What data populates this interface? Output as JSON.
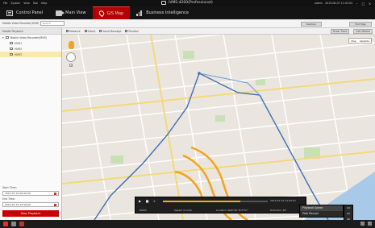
{
  "titlebar": {
    "menu": [
      "File",
      "System",
      "View",
      "Tool",
      "Help"
    ],
    "app_title": "iVMS-4200(Professional)",
    "user_info": "admin",
    "clock": "2015-08-07 11:03:24"
  },
  "tabs": [
    {
      "label": "Control Panel",
      "icon": "control-panel-icon",
      "active": false
    },
    {
      "label": "Main View",
      "icon": "main-view-icon",
      "active": false
    },
    {
      "label": "GIS Map",
      "icon": "gis-map-icon",
      "active": true
    },
    {
      "label": "Business Intelligence",
      "icon": "business-intelligence-icon",
      "active": false
    }
  ],
  "searchrow": {
    "label": "Mobile Video Recorder(MVR)",
    "search_placeholder": "Search",
    "restore_label": "Restore",
    "exit_label": "Exit Map"
  },
  "leftpanel": {
    "header": "Mobile Playback",
    "tree_root": "Mobile Video Recorder(MVR)",
    "tree_items": [
      "MVR1",
      "MVR2",
      "MVR3"
    ],
    "selected_index": 2,
    "start_label": "Start Time:",
    "start_value": "2015-07-31 00:00:00",
    "end_label": "End Time:",
    "end_value": "2015-07-31 23:59:59",
    "stop_label": "Stop Playback"
  },
  "maptoolbar": {
    "items": [
      "Measure",
      "Select",
      "Send Message",
      "Position"
    ],
    "show_track_label": "Show Track",
    "exit_track_label": "Exit Mobile"
  },
  "map": {
    "map_type_options": [
      "Map",
      "Satellite"
    ]
  },
  "playbar": {
    "progress": 0.74,
    "time_display": "2015-07-31 11:03:21",
    "device": "MVR3",
    "speed": "Speed: 0 km/h",
    "location": "Location: N40°45' E73°57'",
    "direction": "Direction: 30°"
  },
  "popup": {
    "items": [
      "Playback Speed",
      "Path Manual"
    ],
    "sub_items": [
      "1X",
      "2X",
      "4X"
    ]
  },
  "colors": {
    "accent": "#b40000",
    "route": "#3f6fb3",
    "progress": "#f3b21c"
  }
}
